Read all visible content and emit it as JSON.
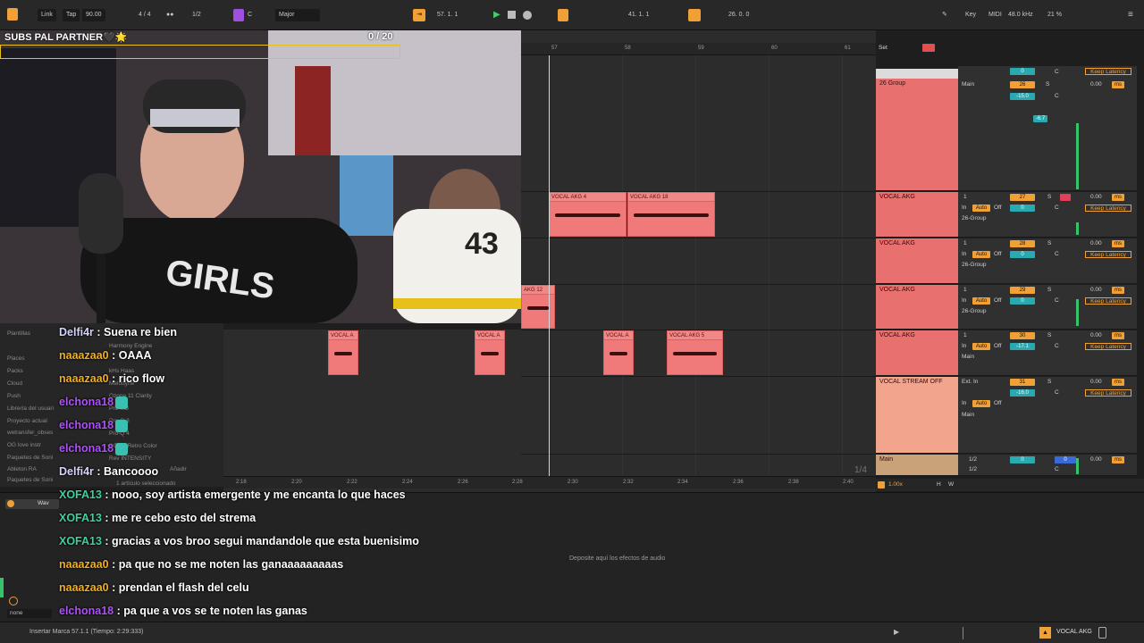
{
  "transport": {
    "link": "Link",
    "tap": "Tap",
    "tempo": "90.00",
    "signature": "4 / 4",
    "quantize": "1/2",
    "key": "C",
    "scale": "Major",
    "position": "57.  1.  1",
    "loop_start": "41.  1.  1",
    "loop_length": "26.  0.  0",
    "key_label": "Key",
    "midi_label": "MIDI",
    "sample_rate": "48.0 kHz",
    "cpu": "21 %"
  },
  "overlay": {
    "subs_goal": "SUBS PAL PARTNER🖤🌟",
    "subs_count": "0  / 20"
  },
  "ruler": {
    "bars": [
      "57",
      "58",
      "59",
      "60",
      "61"
    ],
    "set_label": "Set",
    "times": [
      "2:18",
      "2:20",
      "2:22",
      "2:24",
      "2:26",
      "2:28",
      "2:30",
      "2:32",
      "2:34",
      "2:36",
      "2:38",
      "2:40"
    ]
  },
  "clips": [
    {
      "name": "VOCAL AKG 4"
    },
    {
      "name": "VOCAL AKG 18"
    },
    {
      "name": "AKG 12"
    },
    {
      "name": "VOCAL A"
    },
    {
      "name": "VOCAL A"
    },
    {
      "name": "VOCAL A"
    },
    {
      "name": "VOCAL AKG 5"
    }
  ],
  "tracks": [
    {
      "name": "26 Group",
      "num": "26",
      "vol": "-15.0",
      "pan": "C",
      "send": "-6.7",
      "route": "Main",
      "input": "",
      "group": ""
    },
    {
      "name": "VOCAL AKG",
      "num": "27",
      "vol": "0",
      "pan": "C",
      "send": "",
      "route": "26-Group",
      "input": "1",
      "group": ""
    },
    {
      "name": "VOCAL AKG",
      "num": "28",
      "vol": "0",
      "pan": "C",
      "send": "",
      "route": "26-Group",
      "input": "1",
      "group": ""
    },
    {
      "name": "VOCAL AKG",
      "num": "29",
      "vol": "0",
      "pan": "C",
      "send": "",
      "route": "26-Group",
      "input": "1",
      "group": ""
    },
    {
      "name": "VOCAL AKG",
      "num": "30",
      "vol": "-17.1",
      "pan": "C",
      "send": "",
      "route": "Main",
      "input": "1",
      "group": ""
    },
    {
      "name": "VOCAL STREAM OFF",
      "num": "31",
      "vol": "-16.0",
      "pan": "C",
      "send": "",
      "route": "Main",
      "input": "Ext. In",
      "group": ""
    }
  ],
  "main_track": {
    "name": "Main",
    "vol": "0",
    "pan": "C",
    "in1": "1/2",
    "in2": "1/2"
  },
  "labels": {
    "in": "In",
    "auto": "Auto",
    "off": "Off",
    "solo": "S",
    "keep_latency": "Keep Latency",
    "zero": "0.00",
    "ms": "ms",
    "inf": "-∞",
    "page": "1/4",
    "zoom": "1.00x",
    "h": "H",
    "w": "W"
  },
  "browser": {
    "items": [
      "Plantillas",
      "Places",
      "Packs",
      "Cloud",
      "Push",
      "Librería del usuari",
      "Proyecto actual",
      "wetransfer_obses",
      "OG love instr",
      "Paquetes de Soni",
      "Ableton RA",
      "Paquetes de Soni"
    ],
    "plugins": [
      "Harmony Engine",
      "kHs Haas",
      "Melodyne",
      "Ozone 11 Clarity",
      "Pro-MB",
      "Pro-Q 3",
      "Pro-Q 4",
      "RC-20 Retro Color",
      "Rev INTENSITY"
    ],
    "footer": "1 artículo seleccionado",
    "add": "Añadir"
  },
  "chat": [
    {
      "user": "Delfi4r",
      "color": "#d4d4ff",
      "msg": "Suena re bien"
    },
    {
      "user": "naaazaa0",
      "color": "#f0b020",
      "msg": "OAAA"
    },
    {
      "user": "naaazaa0",
      "color": "#f0b020",
      "msg": "rico flow"
    },
    {
      "user": "elchona18",
      "color": "#b050ff",
      "msg": ""
    },
    {
      "user": "elchona18",
      "color": "#b050ff",
      "msg": ""
    },
    {
      "user": "elchona18",
      "color": "#b050ff",
      "msg": ""
    },
    {
      "user": "Delfi4r",
      "color": "#d4d4ff",
      "msg": "Bancoooo"
    },
    {
      "user": "XOFA13",
      "color": "#40d0a0",
      "msg": "nooo, soy artista emergente y me encanta lo que haces"
    },
    {
      "user": "XOFA13",
      "color": "#40d0a0",
      "msg": "me re cebo esto del strema"
    },
    {
      "user": "XOFA13",
      "color": "#40d0a0",
      "msg": "gracias a vos broo segui mandandole que esta buenisimo"
    },
    {
      "user": "naaazaa0",
      "color": "#f0b020",
      "msg": "pa que no se me noten las ganaaaaaaaaas"
    },
    {
      "user": "naaazaa0",
      "color": "#f0b020",
      "msg": "prendan el flash del celu"
    },
    {
      "user": "elchona18",
      "color": "#b050ff",
      "msg": "pa que a vos se te noten las ganas"
    }
  ],
  "device": {
    "drop_hint": "Deposite aquí los efectos de audio",
    "wave_label": "Wav",
    "none": "none"
  },
  "status": {
    "text": "Insertar Marca 57.1.1 (Tiempo: 2:29:333)",
    "track": "VOCAL AKG"
  },
  "colors": {
    "accent": "#f0a035",
    "clip": "#f07a7a",
    "stream": "#f2a58c",
    "cyan": "#2aa9b0"
  }
}
